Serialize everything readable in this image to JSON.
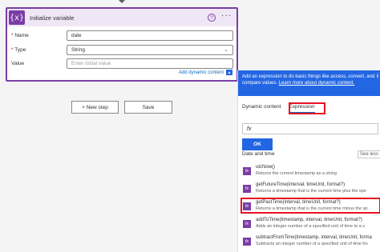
{
  "card": {
    "icon_glyph": "{x}",
    "title": "Initialize variable",
    "help_glyph": "?",
    "more_glyph": "···",
    "fields": {
      "name_label": "Name",
      "name_value": "date",
      "type_label": "Type",
      "type_value": "String",
      "value_label": "Value",
      "value_placeholder": "Enter initial value"
    },
    "dynamic_link": "Add dynamic content"
  },
  "actions": {
    "new_step": "+ New step",
    "save": "Save"
  },
  "panel": {
    "banner": {
      "text": "Add an expression to do basic things like access, convert, and compare values.",
      "link": "Learn more about dynamic content."
    },
    "tabs": [
      "Dynamic content",
      "Expression"
    ],
    "fx_glyph": "fx",
    "ok_label": "OK",
    "section_title": "Date and time",
    "see_less": "See less",
    "functions": [
      {
        "signature": "utcNow()",
        "description": "Returns the current timestamp as a string"
      },
      {
        "signature": "getFutureTime(interval, timeUnit, format?)",
        "description": "Returns a timestamp that is the current time plus the spe"
      },
      {
        "signature": "getPastTime(interval, timeUnit, format?)",
        "description": "Returns a timestamp that is the current time minus the sp"
      },
      {
        "signature": "addToTime(timestamp, interval, timeUnit, format?)",
        "description": "Adds an integer number of a specified unit of time to a s"
      },
      {
        "signature": "subtractFromTime(timestamp, interval, timeUnit, forma",
        "description": "Subtracts an integer number of a specified unit of time fro"
      }
    ]
  },
  "colors": {
    "accent_purple": "#7a3da5",
    "accent_blue": "#2266e3",
    "highlight_red": "#e81123"
  }
}
